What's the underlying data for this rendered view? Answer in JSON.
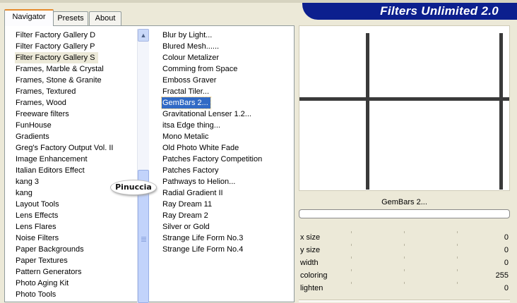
{
  "window": {
    "brand_title": "Filters Unlimited 2.0"
  },
  "tabs": [
    {
      "label": "Navigator",
      "active": true
    },
    {
      "label": "Presets",
      "active": false
    },
    {
      "label": "About",
      "active": false
    }
  ],
  "categories": {
    "items": [
      "Filter Factory Gallery D",
      "Filter Factory Gallery P",
      "Filter Factory Gallery S",
      "Frames, Marble & Crystal",
      "Frames, Stone & Granite",
      "Frames, Textured",
      "Frames, Wood",
      "Freeware filters",
      "FunHouse",
      "Gradients",
      "Greg's Factory Output Vol. II",
      "Image Enhancement",
      "Italian Editors Effect",
      "kang 3",
      "kang",
      "Layout Tools",
      "Lens Effects",
      "Lens Flares",
      "Noise Filters",
      "Paper Backgrounds",
      "Paper Textures",
      "Pattern Generators",
      "Photo Aging Kit",
      "Photo Tools"
    ],
    "selected": "Filter Factory Gallery S"
  },
  "filters": {
    "items": [
      "Blur by Light...",
      "Blured Mesh......",
      "Colour Metalizer",
      "Comming from Space",
      "Emboss Graver",
      "Fractal Tiler...",
      "GemBars 2...",
      "Gravitational Lenser 1.2...",
      "itsa Edge thing...",
      "Mono Metalic",
      "Old Photo White Fade",
      "Patches Factory Competition",
      "Patches Factory",
      "Pathways to Helion...",
      "Radial Gradient II",
      "Ray Dream 11",
      "Ray Dream 2",
      "Silver or Gold",
      "Strange Life Form No.3",
      "Strange Life Form No.4"
    ],
    "selected": "GemBars 2..."
  },
  "watermark": {
    "text": "Pinuccia"
  },
  "preview": {
    "filter_name": "GemBars 2...",
    "progress": 0
  },
  "parameters": [
    {
      "label": "x size",
      "value": "0"
    },
    {
      "label": "y size",
      "value": "0"
    },
    {
      "label": "width",
      "value": "0"
    },
    {
      "label": "coloring",
      "value": "255"
    },
    {
      "label": "lighten",
      "value": "0"
    }
  ],
  "colors": {
    "brand_bg": "#0c1f8e",
    "selection": "#316ac5",
    "tab_accent": "#e68b2c",
    "preview_bars": "#3a3a3a"
  },
  "icons": {
    "scroll_up": "chevron-up-icon",
    "scroll_grip": "grip-icon"
  }
}
